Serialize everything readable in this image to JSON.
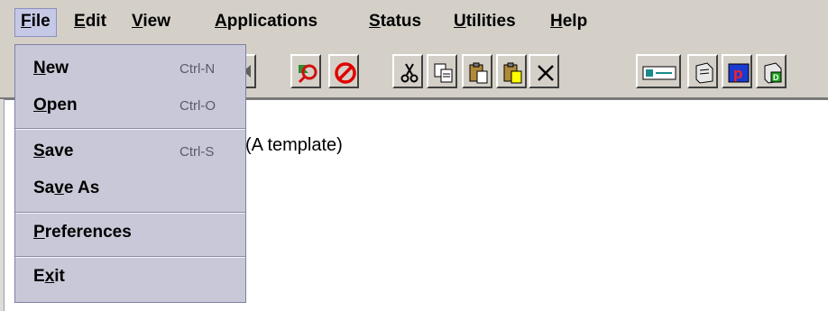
{
  "menubar": {
    "items": [
      {
        "label": "File",
        "mnemonic": "F",
        "rest": "ile",
        "active": true
      },
      {
        "label": "Edit",
        "mnemonic": "E",
        "rest": "dit"
      },
      {
        "label": "View",
        "mnemonic": "V",
        "rest": "iew"
      },
      {
        "label": "Applications",
        "mnemonic": "A",
        "rest": "pplications"
      },
      {
        "label": "Status",
        "mnemonic": "S",
        "rest": "tatus"
      },
      {
        "label": "Utilities",
        "mnemonic": "U",
        "rest": "tilities"
      },
      {
        "label": "Help",
        "mnemonic": "H",
        "rest": "elp"
      }
    ]
  },
  "file_menu": {
    "items": [
      {
        "pre": "",
        "mn": "N",
        "post": "ew",
        "shortcut": "Ctrl-N"
      },
      {
        "pre": "",
        "mn": "O",
        "post": "pen",
        "shortcut": "Ctrl-O"
      },
      {
        "pre": "",
        "mn": "S",
        "post": "ave",
        "shortcut": "Ctrl-S"
      },
      {
        "pre": "Sa",
        "mn": "v",
        "post": "e As",
        "shortcut": ""
      },
      {
        "pre": "",
        "mn": "P",
        "post": "references",
        "shortcut": ""
      },
      {
        "pre": "E",
        "mn": "x",
        "post": "it",
        "shortcut": ""
      }
    ]
  },
  "toolbar": {
    "icons": [
      "arrow-icon",
      "search-globe-icon",
      "stop-icon",
      "cut-icon",
      "copy-icon",
      "paste-icon",
      "paste-special-icon",
      "delete-icon",
      "terminal-icon",
      "document-icon",
      "program-icon",
      "data-document-icon"
    ]
  },
  "content": {
    "text": "(A template)"
  },
  "colors": {
    "menubar_bg": "#d4d0c8",
    "menu_active_bg": "#c5c9e6",
    "dropdown_bg": "#c8c8d8"
  }
}
